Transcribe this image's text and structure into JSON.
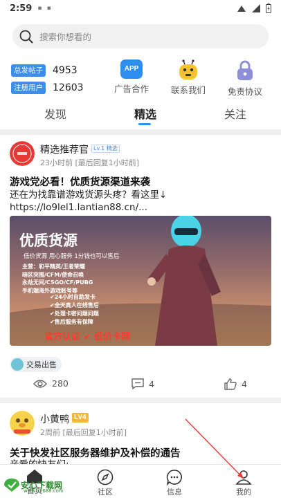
{
  "status_bar": {
    "time": "2:59"
  },
  "search": {
    "placeholder": "搜索你想看的"
  },
  "stats": [
    {
      "label": "总发帖子",
      "value": "4953"
    },
    {
      "label": "注册用户",
      "value": "12603"
    }
  ],
  "shortcuts": [
    {
      "icon": "app-icon",
      "icon_text": "APP",
      "label": "广告合作"
    },
    {
      "icon": "robot-icon",
      "label": "联系我们"
    },
    {
      "icon": "lock-icon",
      "label": "免责协议"
    }
  ],
  "tabs": [
    {
      "label": "发现",
      "active": false
    },
    {
      "label": "精选",
      "active": true
    },
    {
      "label": "关注",
      "active": false
    }
  ],
  "posts": [
    {
      "author": "精选推荐官",
      "level": "Lv.1 精选",
      "meta": "23小时前 [最后回复1小时前]",
      "title": "游戏党必看！优质货源渠道来袭",
      "body_line1": "还在为找靠谱游戏货源头疼？看这里↓",
      "body_line2": "https://lo9lel1.lantian88.cn/...",
      "banner": {
        "title": "优质货源",
        "subtitle": "低价货源 用心服务 1分钱也可以售后",
        "lines": [
          "主营：和平精英/王者荣耀",
          "暗区突围/CFM/使命召唤",
          "永劫无间/CSGO/CF/PUBG",
          "手机端海外游戏账号等"
        ],
        "checks": [
          "✔24小时自助发卡",
          "✔全天真人在线售后",
          "✔处理卡密问题问题",
          "✔售后服务有保障"
        ],
        "footer": "官方认证 ✔ 低价卡网"
      },
      "tag": "交易出售",
      "views": "280",
      "comments": "4",
      "likes": "4"
    },
    {
      "author": "小黄鸭",
      "level": "LV4",
      "meta": "2周前 [最后回复1小时前]",
      "title": "关于快发社区服务器维护及补偿的通告",
      "body_line1": "亲爱的快友们:"
    }
  ],
  "bottom_nav": [
    {
      "label": "首页",
      "icon": "home-icon"
    },
    {
      "label": "社区",
      "icon": "compass-icon"
    },
    {
      "label": "信息",
      "icon": "chat-icon"
    },
    {
      "label": "我的",
      "icon": "user-icon"
    }
  ],
  "watermark": {
    "text": "安心下载网",
    "url": "www.ax688.com"
  },
  "colors": {
    "accent": "#2f8ff0",
    "badge": "#3b8eea",
    "annotation_arrow": "#e53935"
  }
}
